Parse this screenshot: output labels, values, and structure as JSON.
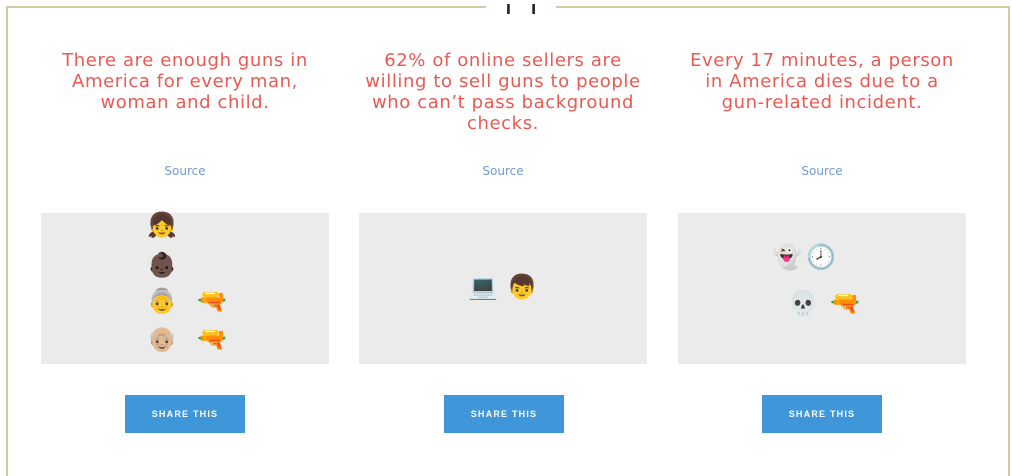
{
  "cards": [
    {
      "stat": "There are enough guns in America for every man, woman and child.",
      "source_label": "Source",
      "emojis": [
        "girl-face-icon",
        "baby-face-icon",
        "old-woman-icon",
        "gun-icon",
        "old-man-icon",
        "gun-icon"
      ],
      "share_label": "SHARE THIS"
    },
    {
      "stat": "62% of online sellers are willing to sell guns to people who can’t pass background checks.",
      "source_label": "Source",
      "emojis": [
        "computer-icon",
        "boy-face-icon"
      ],
      "share_label": "SHARE THIS"
    },
    {
      "stat": "Every 17 minutes, a person in America dies due to a gun-related incident.",
      "source_label": "Source",
      "emojis": [
        "ghost-icon",
        "clock-icon",
        "skull-icon",
        "gun-icon"
      ],
      "share_label": "SHARE THIS"
    }
  ],
  "colors": {
    "stat_text": "#e85a52",
    "link": "#6f9ad1",
    "button": "#3f97d9",
    "panel": "#ebebeb",
    "frame": "#d6c9a3"
  }
}
